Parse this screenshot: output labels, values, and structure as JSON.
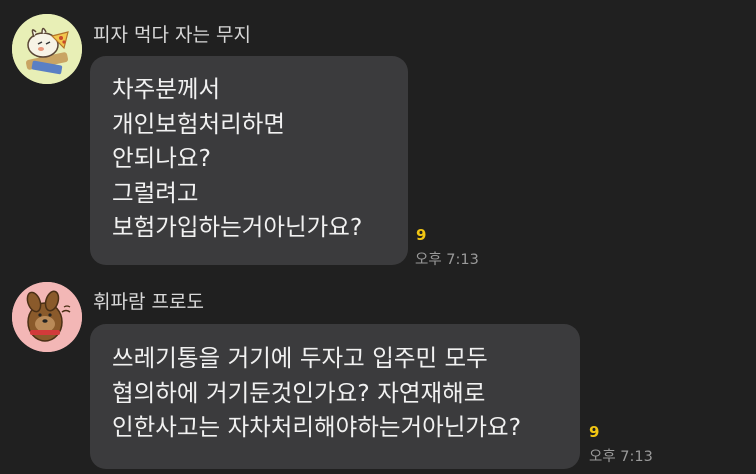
{
  "messages": [
    {
      "sender": "피자 먹다 자는 무지",
      "avatar_icon": "muzi-pizza-sticker-icon",
      "lines": [
        "차주분께서",
        "개인보험처리하면",
        "안되나요?",
        "그럴려고",
        "보험가입하는거아닌가요?"
      ],
      "unread_count": "9",
      "time": "오후 7:13"
    },
    {
      "sender": "휘파람 프로도",
      "avatar_icon": "frodo-whistle-sticker-icon",
      "lines": [
        "쓰레기통을 거기에 두자고 입주민 모두",
        "협의하에 거기둔것인가요? 자연재해로",
        "인한사고는 자차처리해야하는거아닌가요?"
      ],
      "unread_count": "9",
      "time": "오후 7:13"
    }
  ],
  "colors": {
    "background": "#202020",
    "bubble": "#3b3b3d",
    "unread": "#f2c613",
    "time": "#9a9a9a"
  }
}
